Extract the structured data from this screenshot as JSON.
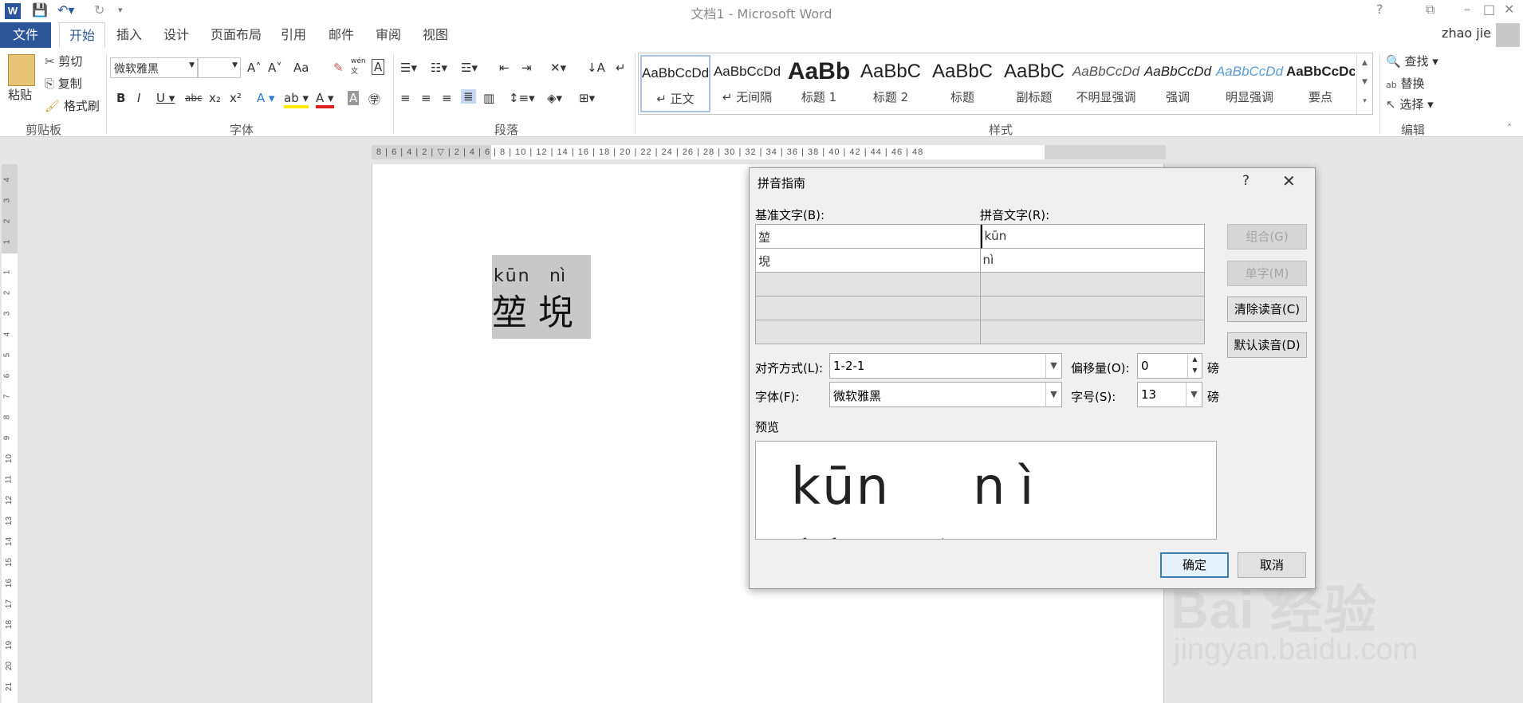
{
  "titlebar": {
    "title": "文档1 - Microsoft Word",
    "icons": [
      "word-logo-icon",
      "save-icon",
      "undo-icon",
      "redo-icon",
      "customize-icon",
      "help-icon",
      "ribbon-display-icon",
      "minimize-icon",
      "maximize-icon",
      "close-icon"
    ]
  },
  "tabs": {
    "file": "文件",
    "items": [
      "开始",
      "插入",
      "设计",
      "页面布局",
      "引用",
      "邮件",
      "审阅",
      "视图"
    ],
    "active": "开始",
    "user": "zhao jie"
  },
  "ribbon": {
    "clipboard": {
      "paste": "粘贴",
      "cut": "剪切",
      "copy": "复制",
      "format_painter": "格式刷",
      "label": "剪贴板"
    },
    "font": {
      "name": "微软雅黑",
      "size": "",
      "label": "字体",
      "change_case": "Aa",
      "pinyin": "wén"
    },
    "paragraph": {
      "label": "段落"
    },
    "styles": {
      "label": "样式",
      "items": [
        {
          "preview": "AaBbCcDd",
          "name": "↵ 正文"
        },
        {
          "preview": "AaBbCcDd",
          "name": "↵ 无间隔"
        },
        {
          "preview": "AaBb",
          "name": "标题 1"
        },
        {
          "preview": "AaBbC",
          "name": "标题 2"
        },
        {
          "preview": "AaBbC",
          "name": "标题"
        },
        {
          "preview": "AaBbC",
          "name": "副标题"
        },
        {
          "preview": "AaBbCcDd",
          "name": "不明显强调"
        },
        {
          "preview": "AaBbCcDd",
          "name": "强调"
        },
        {
          "preview": "AaBbCcDd",
          "name": "明显强调"
        },
        {
          "preview": "AaBbCcDc",
          "name": "要点"
        }
      ]
    },
    "editing": {
      "find": "查找",
      "replace": "替换",
      "select": "选择",
      "label": "编辑"
    }
  },
  "ruler": {
    "horizontal": "8 | 6 | 4 | 2 | ▽ | 2 | 4 | 6 | 8 | 10 | 12 | 14 | 16 | 18 | 20 | 22 | 24 | 26 | 28 | 30 | 32 | 34 | 36 | 38 | 40 | 42 | 44 | 46 | 48",
    "corner": "L",
    "vertical_top": [
      "4",
      "3",
      "2",
      "1"
    ],
    "vertical_main": [
      "1",
      "2",
      "3",
      "4",
      "5",
      "6",
      "7",
      "8",
      "9",
      "10",
      "11",
      "12",
      "13",
      "14",
      "15",
      "16",
      "17",
      "18",
      "19",
      "20",
      "21"
    ]
  },
  "document": {
    "pinyin1": "kūn",
    "pinyin2": "nì",
    "hanzi": "堃 堄"
  },
  "dialog": {
    "title": "拼音指南",
    "help": "?",
    "close": "✕",
    "base_label": "基准文字(B):",
    "ruby_label": "拼音文字(R):",
    "rows": [
      {
        "base": "堃",
        "ruby": "kūn"
      },
      {
        "base": "堄",
        "ruby": "nì"
      },
      {
        "base": "",
        "ruby": ""
      },
      {
        "base": "",
        "ruby": ""
      },
      {
        "base": "",
        "ruby": ""
      }
    ],
    "group_btn": "组合(G)",
    "mono_btn": "单字(M)",
    "clear_btn": "清除读音(C)",
    "default_btn": "默认读音(D)",
    "align_label": "对齐方式(L):",
    "align_value": "1-2-1",
    "offset_label": "偏移量(O):",
    "offset_value": "0",
    "offset_unit": "磅",
    "font_label": "字体(F):",
    "font_value": "微软雅黑",
    "size_label": "字号(S):",
    "size_value": "13",
    "size_unit": "磅",
    "preview_label": "预览",
    "preview_pinyin1": "kūn",
    "preview_pinyin2": "nì",
    "preview_hanzi": "堃堄",
    "ok": "确定",
    "cancel": "取消"
  },
  "watermark": {
    "brand": "Bai 经验",
    "url": "jingyan.baidu.com"
  }
}
